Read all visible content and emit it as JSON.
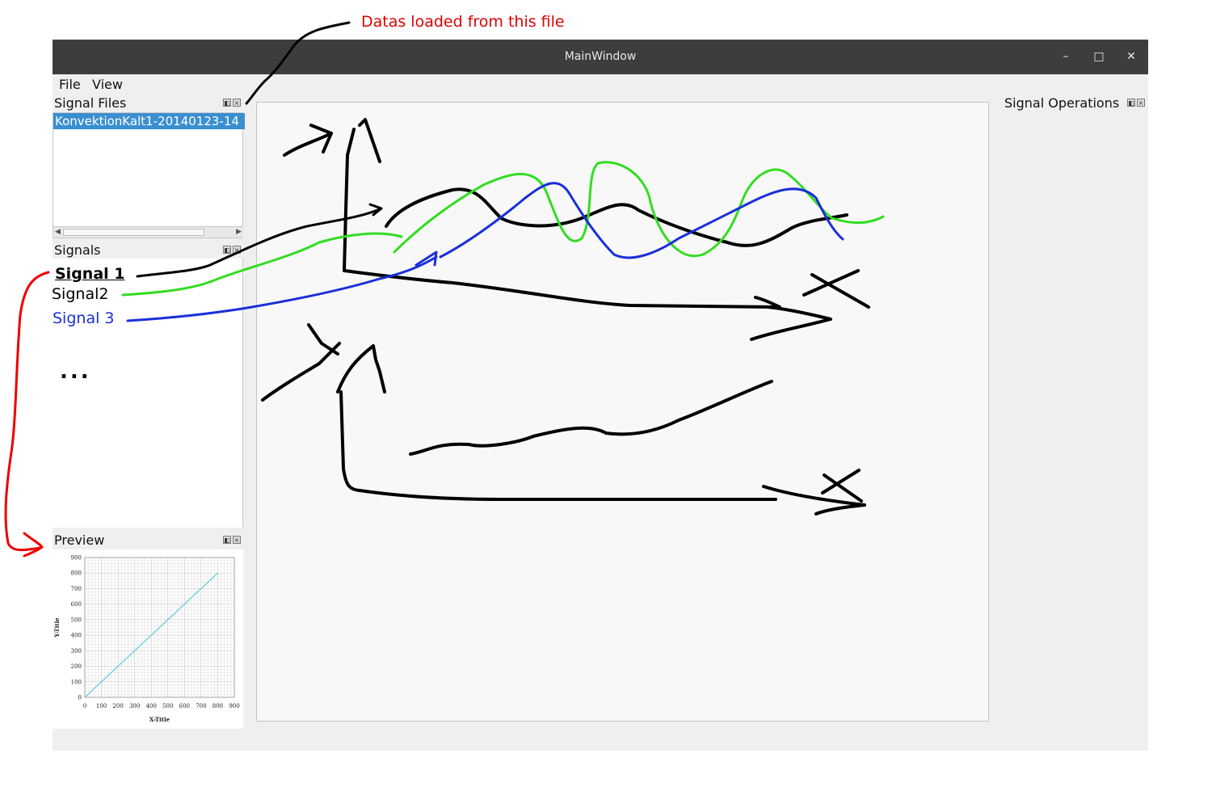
{
  "annotation": {
    "note": "Datas loaded from this file"
  },
  "window": {
    "title": "MainWindow",
    "controls": {
      "minimize": "–",
      "maximize": "□",
      "close": "✕"
    }
  },
  "menu": {
    "items": [
      "File",
      "View"
    ]
  },
  "docks": {
    "signal_files": {
      "title": "Signal Files",
      "file": "KonvektionKalt1-20140123-14"
    },
    "signals": {
      "title": "Signals",
      "items": [
        {
          "label": "Signal 1",
          "color": "#000000"
        },
        {
          "label": "Signal2",
          "color": "#111111"
        },
        {
          "label": "Signal 3",
          "color": "#1a2fd8"
        }
      ],
      "more": "..."
    },
    "preview": {
      "title": "Preview"
    },
    "signal_operations": {
      "title": "Signal Operations"
    }
  },
  "chart_data": {
    "type": "line",
    "xlabel": "X-Title",
    "ylabel": "Y-Title",
    "xlim": [
      0,
      900
    ],
    "ylim": [
      0,
      900
    ],
    "xticks": [
      "0",
      "100",
      "200",
      "300",
      "400",
      "500",
      "600",
      "700",
      "800",
      "900"
    ],
    "yticks": [
      "0",
      "100",
      "200",
      "300",
      "400",
      "500",
      "600",
      "700",
      "800",
      "900"
    ],
    "grid": true,
    "series": [
      {
        "color": "#3cc8e0",
        "x": [
          0,
          800
        ],
        "y": [
          0,
          800
        ]
      }
    ]
  }
}
